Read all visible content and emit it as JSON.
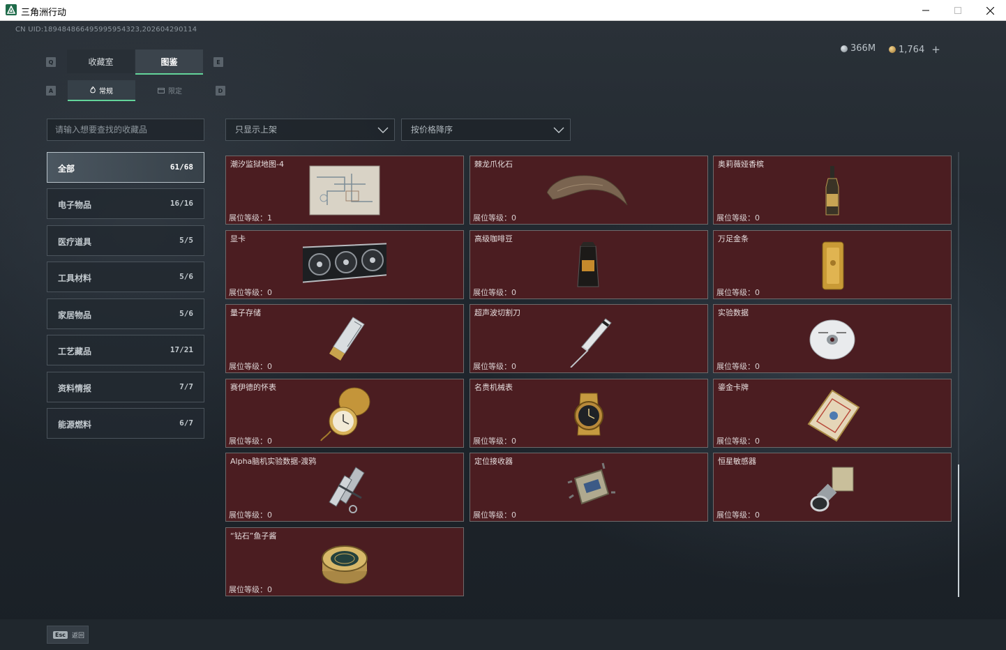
{
  "window": {
    "title": "三角洲行动"
  },
  "header": {
    "uid": "CN UID:189484866495995954323,202604290114",
    "currency": [
      {
        "icon": "silver-coin-icon",
        "value": "366M"
      },
      {
        "icon": "gold-coin-icon",
        "value": "1,764"
      }
    ],
    "add_label": "+"
  },
  "tabs": {
    "prev_key": "Q",
    "next_key": "E",
    "items": [
      {
        "label": "收藏室",
        "active": false
      },
      {
        "label": "图鉴",
        "active": true
      }
    ]
  },
  "subtabs": {
    "prev_key": "A",
    "next_key": "D",
    "items": [
      {
        "label": "常规",
        "icon": "flame-icon",
        "active": true
      },
      {
        "label": "限定",
        "icon": "calendar-icon",
        "active": false
      }
    ]
  },
  "search": {
    "placeholder": "请输入想要查找的收藏品"
  },
  "filters": {
    "shelf": "只显示上架",
    "sort": "按价格降序"
  },
  "categories": [
    {
      "name": "全部",
      "count": "61/68",
      "selected": true
    },
    {
      "name": "电子物品",
      "count": "16/16"
    },
    {
      "name": "医疗道具",
      "count": "5/5"
    },
    {
      "name": "工具材料",
      "count": "5/6"
    },
    {
      "name": "家居物品",
      "count": "5/6"
    },
    {
      "name": "工艺藏品",
      "count": "17/21"
    },
    {
      "name": "资料情报",
      "count": "7/7"
    },
    {
      "name": "能源燃料",
      "count": "6/7"
    }
  ],
  "items": [
    {
      "name": "潮汐监狱地图-4",
      "level": "展位等级：1",
      "icon": "map-icon"
    },
    {
      "name": "棘龙爪化石",
      "level": "展位等级：0",
      "icon": "claw-fossil-icon"
    },
    {
      "name": "奥莉薇娅香槟",
      "level": "展位等级：0",
      "icon": "champagne-icon"
    },
    {
      "name": "显卡",
      "level": "展位等级：0",
      "icon": "graphics-card-icon"
    },
    {
      "name": "高级咖啡豆",
      "level": "展位等级：0",
      "icon": "coffee-bag-icon"
    },
    {
      "name": "万足金条",
      "level": "展位等级：0",
      "icon": "gold-bar-icon"
    },
    {
      "name": "量子存储",
      "level": "展位等级：0",
      "icon": "usb-drive-icon"
    },
    {
      "name": "超声波切割刀",
      "level": "展位等级：0",
      "icon": "ultrasonic-cutter-icon"
    },
    {
      "name": "实验数据",
      "level": "展位等级：0",
      "icon": "disc-icon"
    },
    {
      "name": "赛伊德的怀表",
      "level": "展位等级：0",
      "icon": "pocket-watch-icon"
    },
    {
      "name": "名贵机械表",
      "level": "展位等级：0",
      "icon": "wristwatch-icon"
    },
    {
      "name": "鎏金卡牌",
      "level": "展位等级：0",
      "icon": "gold-card-icon"
    },
    {
      "name": "Alpha脑机实验数据-渡鸦",
      "level": "展位等级：0",
      "icon": "data-canister-icon"
    },
    {
      "name": "定位接收器",
      "level": "展位等级：0",
      "icon": "gps-receiver-icon"
    },
    {
      "name": "恒星敏感器",
      "level": "展位等级：0",
      "icon": "star-sensor-icon"
    },
    {
      "name": "“钻石”鱼子酱",
      "level": "展位等级：0",
      "icon": "caviar-tin-icon"
    }
  ],
  "footer": {
    "key": "Esc",
    "label": "返回"
  }
}
